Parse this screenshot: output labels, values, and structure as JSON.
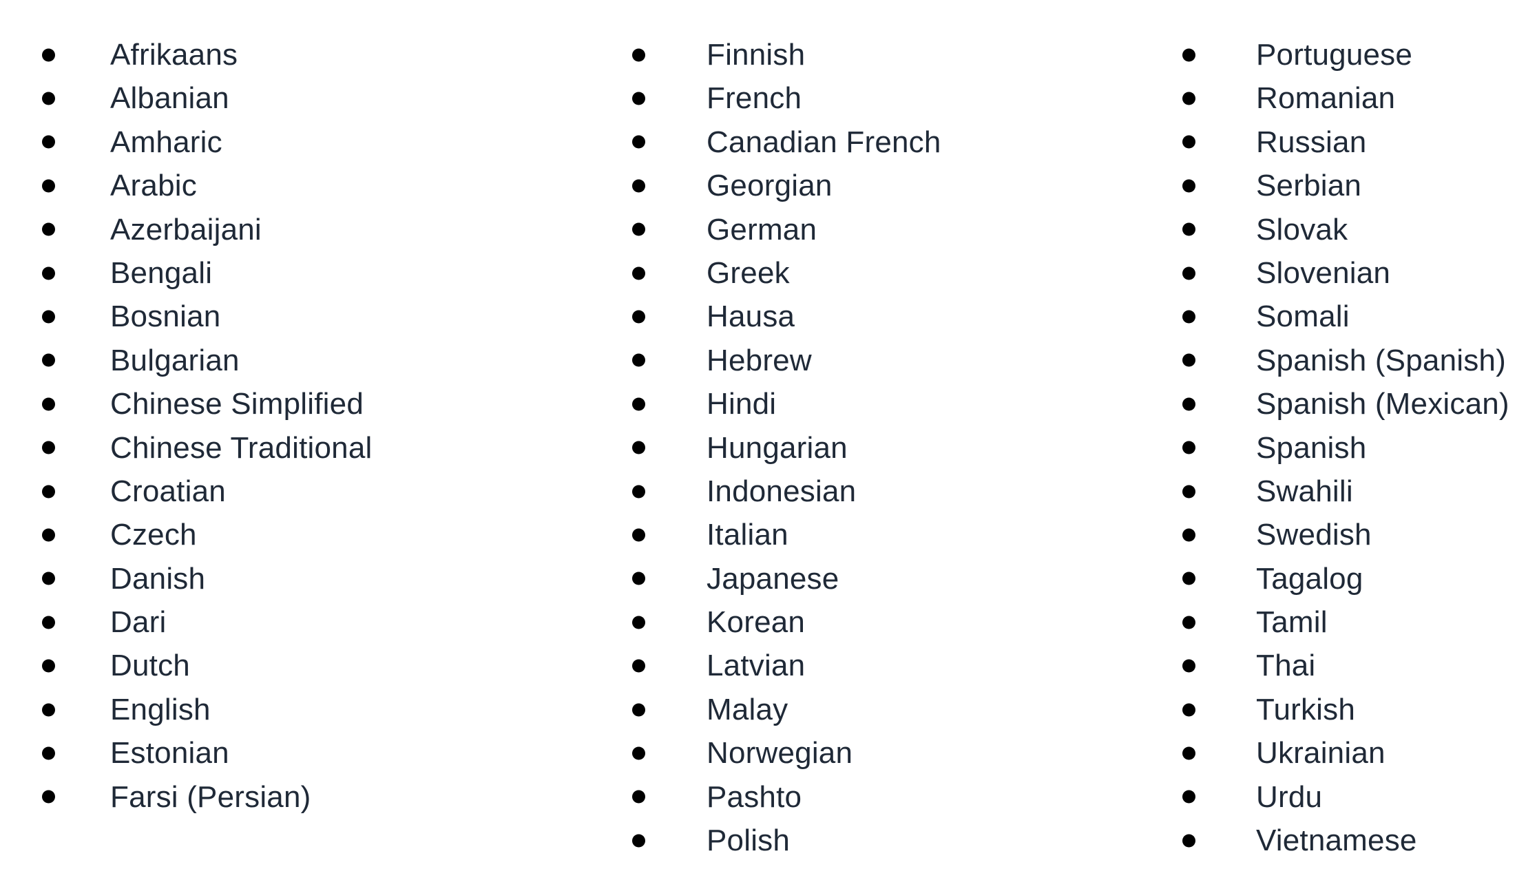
{
  "text_color": "#1f2937",
  "bullet_color": "#000000",
  "columns": [
    {
      "items": [
        "Afrikaans",
        "Albanian",
        "Amharic",
        "Arabic",
        "Azerbaijani",
        "Bengali",
        "Bosnian",
        "Bulgarian",
        "Chinese Simplified",
        "Chinese Traditional",
        "Croatian",
        "Czech",
        "Danish",
        "Dari",
        "Dutch",
        "English",
        "Estonian",
        "Farsi (Persian)"
      ]
    },
    {
      "items": [
        "Finnish",
        "French",
        "Canadian French",
        "Georgian",
        "German",
        "Greek",
        "Hausa",
        "Hebrew",
        "Hindi",
        "Hungarian",
        "Indonesian",
        "Italian",
        "Japanese",
        "Korean",
        "Latvian",
        "Malay",
        "Norwegian",
        "Pashto",
        "Polish"
      ]
    },
    {
      "items": [
        "Portuguese",
        "Romanian",
        "Russian",
        "Serbian",
        "Slovak",
        "Slovenian",
        "Somali",
        "Spanish (Spanish)",
        "Spanish (Mexican)",
        "Spanish",
        "Swahili",
        "Swedish",
        "Tagalog",
        "Tamil",
        "Thai",
        "Turkish",
        "Ukrainian",
        "Urdu",
        "Vietnamese"
      ]
    }
  ]
}
